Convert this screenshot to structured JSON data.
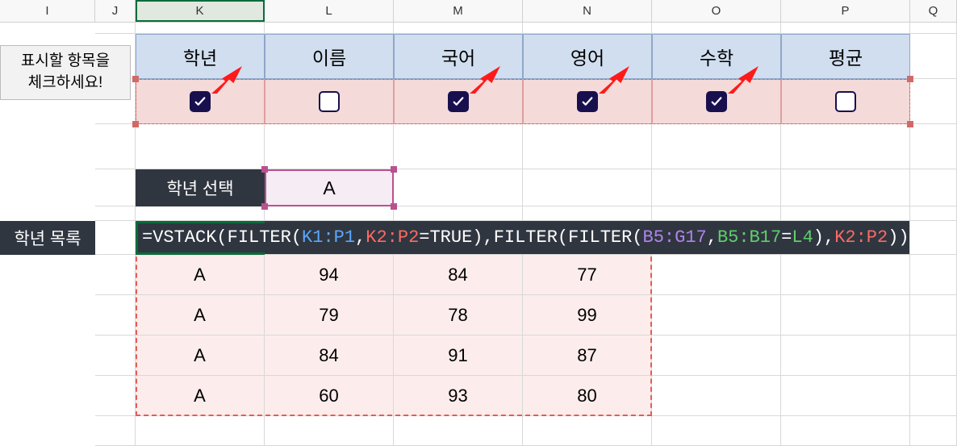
{
  "columns": [
    "I",
    "J",
    "K",
    "L",
    "M",
    "N",
    "O",
    "P",
    "Q"
  ],
  "selected_column": "K",
  "note": "표시할 항목을\n체크하세요!",
  "headers": [
    "학년",
    "이름",
    "국어",
    "영어",
    "수학",
    "평균"
  ],
  "checks": [
    true,
    false,
    true,
    true,
    true,
    false
  ],
  "arrows_on": [
    true,
    false,
    true,
    true,
    true,
    false
  ],
  "grade_select": {
    "label": "학년 선택",
    "value": "A"
  },
  "list_label": "학년 목록",
  "formula": {
    "prefix": "=VSTACK(FILTER(",
    "r1": "K1:P1",
    "comma1": ",",
    "r2": "K2:P2",
    "eqtrue": "=TRUE",
    "mid": "),FILTER(FILTER(",
    "r3": "B5:G17",
    "comma2": ",",
    "r4": "B5:B17",
    "eq": "=",
    "r4b": "L4",
    "mid2": "),",
    "r5": "K2:P2",
    "tail": "))"
  },
  "results": [
    [
      "A",
      "94",
      "84",
      "77"
    ],
    [
      "A",
      "79",
      "78",
      "99"
    ],
    [
      "A",
      "84",
      "91",
      "87"
    ],
    [
      "A",
      "60",
      "93",
      "80"
    ]
  ]
}
